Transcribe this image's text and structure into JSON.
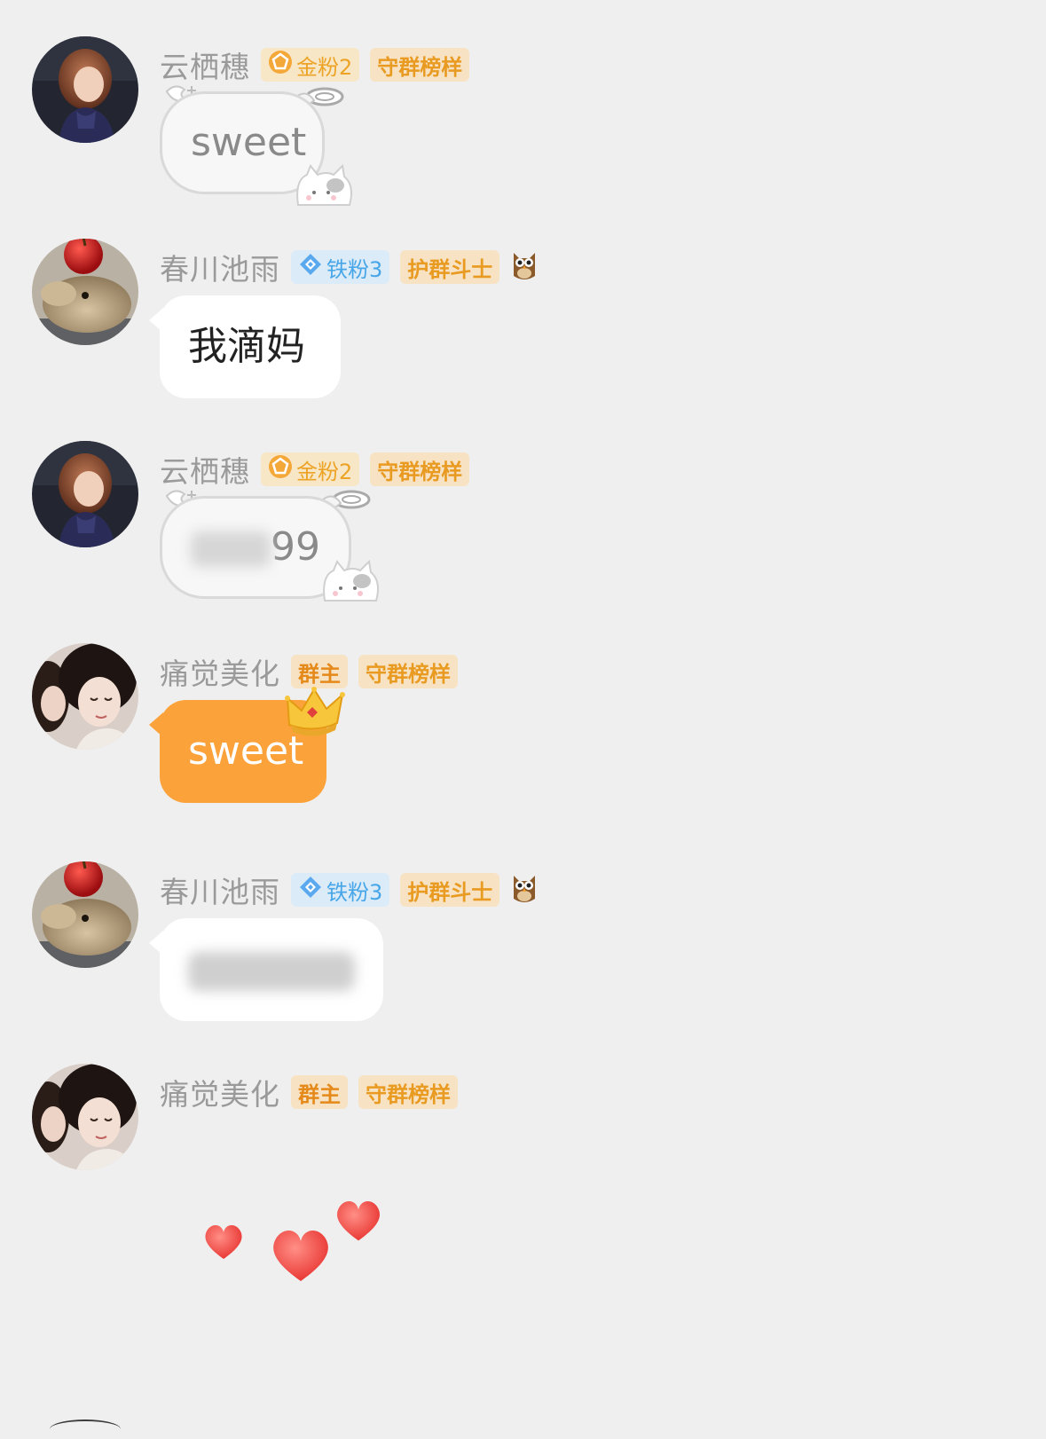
{
  "messages": [
    {
      "name": "云栖穗",
      "badge1": "金粉2",
      "badge2": "守群榜样",
      "text": "sweet"
    },
    {
      "name": "春川池雨",
      "badge1": "铁粉3",
      "badge2": "护群斗士",
      "text": "我滴妈"
    },
    {
      "name": "云栖穗",
      "badge1": "金粉2",
      "badge2": "守群榜样",
      "text_visible": "99"
    },
    {
      "name": "痛觉美化",
      "badge1": "群主",
      "badge2": "守群榜样",
      "text": "sweet"
    },
    {
      "name": "春川池雨",
      "badge1": "铁粉3",
      "badge2": "护群斗士"
    },
    {
      "name": "痛觉美化",
      "badge1": "群主",
      "badge2": "守群榜样"
    }
  ],
  "colors": {
    "background": "#efefef",
    "owner_bubble": "#fba23a",
    "gold_badge": "#eca326",
    "iron_badge": "#47a6e8"
  },
  "icons": {
    "gold_badge": "pentagon-medal-icon",
    "iron_badge": "diamond-icon",
    "owl": "owl-icon",
    "crown": "crown-icon",
    "cat": "cat-icon",
    "halo": "halo-wings-icon",
    "hearts": "heart-icon"
  }
}
